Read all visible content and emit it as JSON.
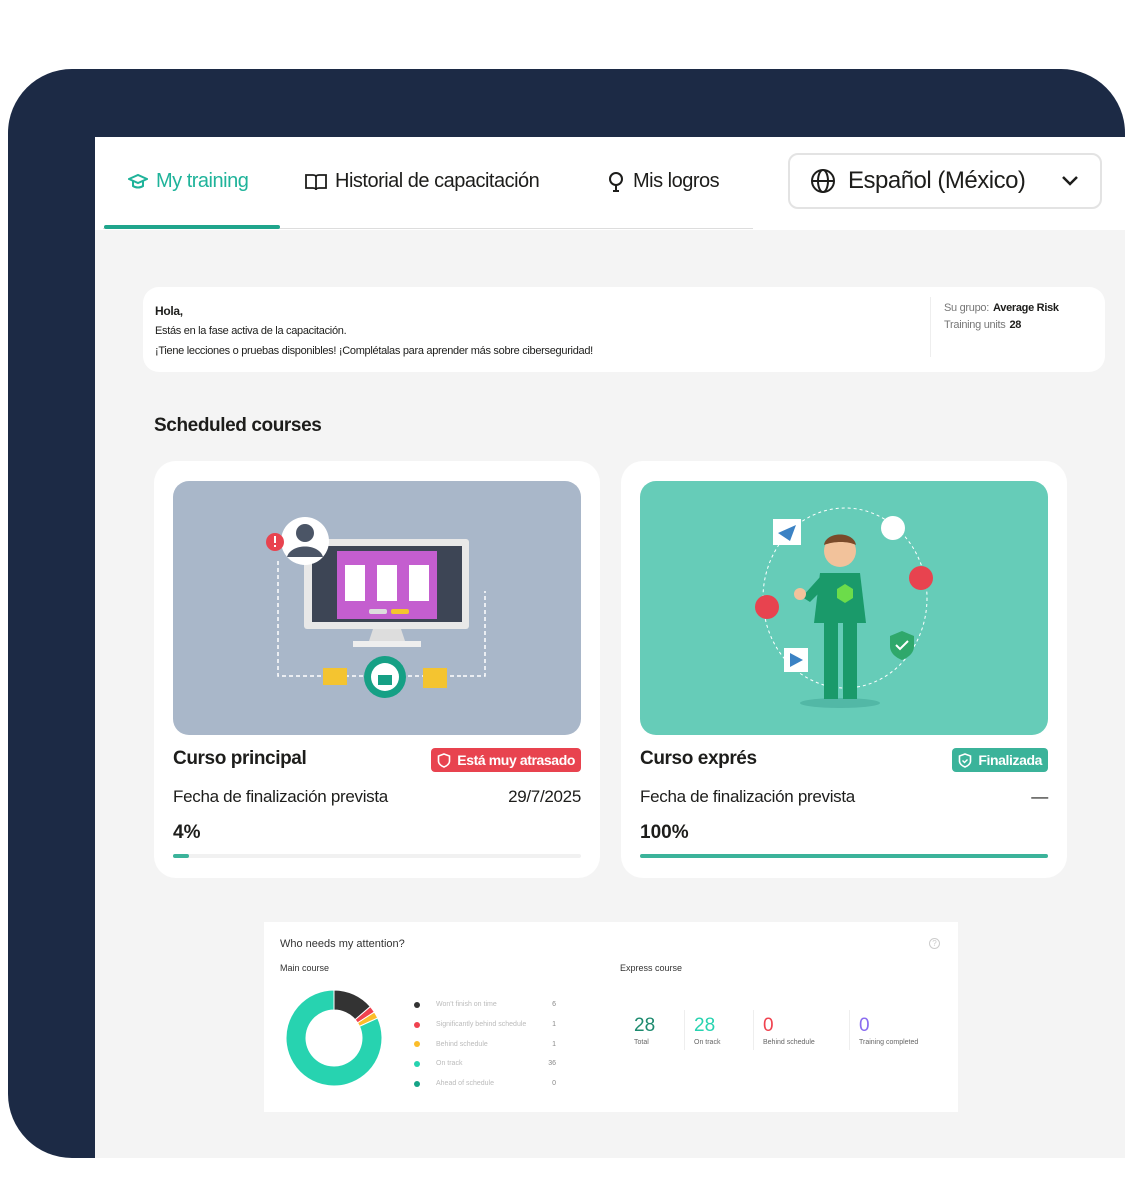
{
  "tabs": [
    {
      "label": "My training",
      "icon": "graduation-cap-icon",
      "active": true
    },
    {
      "label": "Historial de capacitación",
      "icon": "book-icon"
    },
    {
      "label": "Mis logros",
      "icon": "trophy-icon"
    }
  ],
  "language": {
    "label": "Español (México)",
    "icon": "globe-icon"
  },
  "info": {
    "greeting": "Hola,",
    "line1": "Estás en la fase activa de la capacitación.",
    "line2": "¡Tiene lecciones o pruebas disponibles! ¡Complétalas para aprender más sobre ciberseguridad!",
    "group_label": "Su grupo:",
    "group_value": "Average Risk",
    "units_label": "Training units",
    "units_value": "28"
  },
  "scheduled_title": "Scheduled courses",
  "courses": [
    {
      "title": "Curso principal",
      "badge": "Está muy atrasado",
      "badge_color": "#e8434f",
      "date_label": "Fecha de finalización prevista",
      "date": "29/7/2025",
      "progress_label": "4%",
      "progress": 4
    },
    {
      "title": "Curso exprés",
      "badge": "Finalizada",
      "badge_color": "#3bb39a",
      "date_label": "Fecha de finalización prevista",
      "date": "—",
      "progress_label": "100%",
      "progress": 100
    }
  ],
  "attention": {
    "title": "Who needs my attention?",
    "main_label": "Main course",
    "express_label": "Express course",
    "legend": [
      {
        "label": "Won't finish on time",
        "value": "6",
        "color": "#333333"
      },
      {
        "label": "Significantly behind schedule",
        "value": "1",
        "color": "#f0424f"
      },
      {
        "label": "Behind schedule",
        "value": "1",
        "color": "#fbbd2a"
      },
      {
        "label": "On track",
        "value": "36",
        "color": "#27d3b0"
      },
      {
        "label": "Ahead of schedule",
        "value": "0",
        "color": "#15a386"
      }
    ],
    "stats": [
      {
        "value": "28",
        "label": "Total",
        "color": "#1c8a6e"
      },
      {
        "value": "28",
        "label": "On track",
        "color": "#27d3b0"
      },
      {
        "value": "0",
        "label": "Behind schedule",
        "color": "#f0424f"
      },
      {
        "value": "0",
        "label": "Training completed",
        "color": "#8a6cf0"
      }
    ]
  }
}
